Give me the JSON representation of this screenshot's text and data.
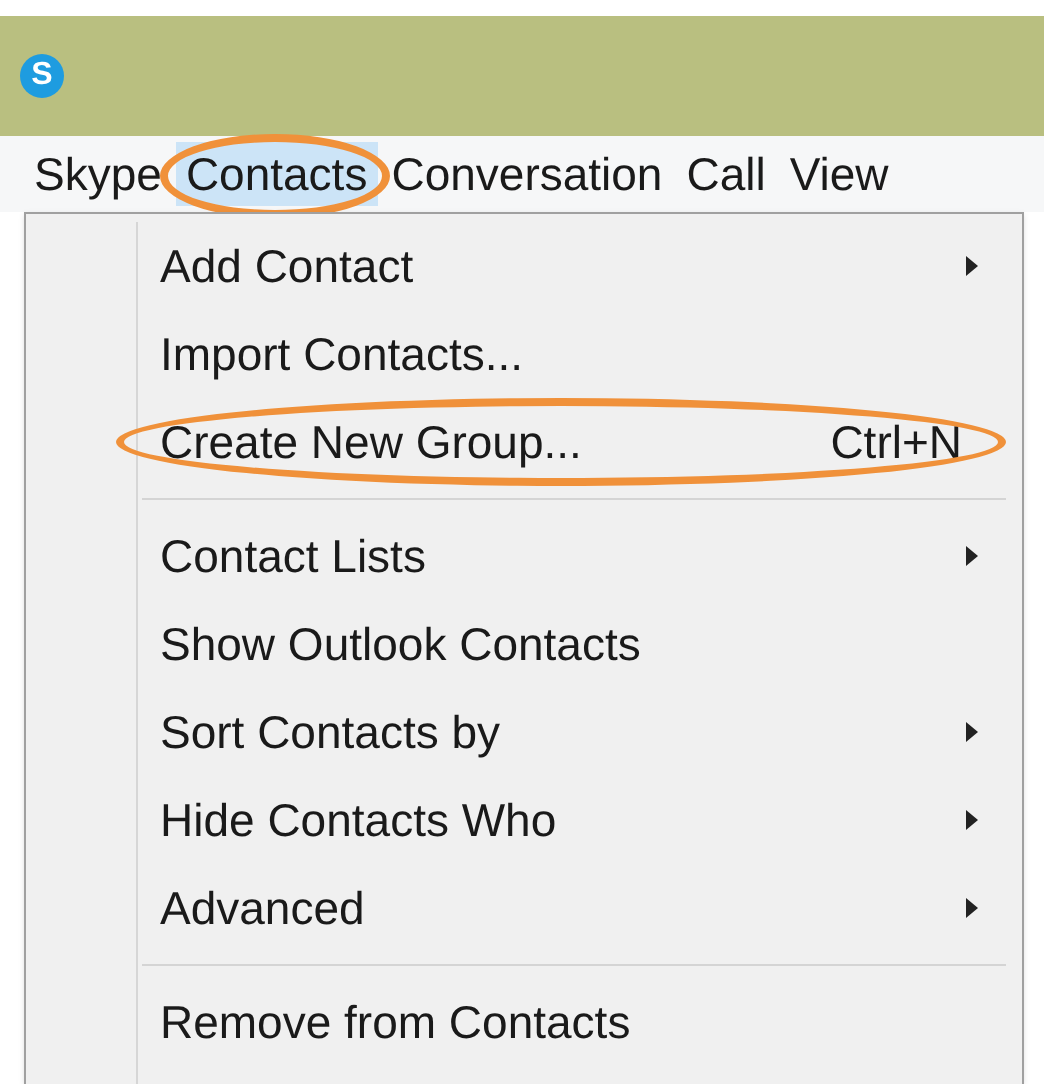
{
  "title_bar": {
    "logo_letter": "S"
  },
  "menu_bar": [
    {
      "label": "Skype",
      "selected": false,
      "annotated": false
    },
    {
      "label": "Contacts",
      "selected": true,
      "annotated": true
    },
    {
      "label": "Conversation",
      "selected": false,
      "annotated": false
    },
    {
      "label": "Call",
      "selected": false,
      "annotated": false
    },
    {
      "label": "View",
      "selected": false,
      "annotated": false
    }
  ],
  "menu": {
    "items": [
      {
        "kind": "item",
        "label": "Add Contact",
        "submenu": true,
        "annotated": false
      },
      {
        "kind": "item",
        "label": "Import Contacts...",
        "submenu": false,
        "annotated": false
      },
      {
        "kind": "item",
        "label": "Create New Group...",
        "shortcut": "Ctrl+N",
        "submenu": false,
        "annotated": true
      },
      {
        "kind": "separator"
      },
      {
        "kind": "item",
        "label": "Contact Lists",
        "submenu": true,
        "annotated": false
      },
      {
        "kind": "item",
        "label": "Show Outlook Contacts",
        "submenu": false,
        "annotated": false
      },
      {
        "kind": "item",
        "label": "Sort Contacts by",
        "submenu": true,
        "annotated": false
      },
      {
        "kind": "item",
        "label": "Hide Contacts Who",
        "submenu": true,
        "annotated": false
      },
      {
        "kind": "item",
        "label": "Advanced",
        "submenu": true,
        "annotated": false
      },
      {
        "kind": "separator"
      },
      {
        "kind": "item",
        "label": "Remove from Contacts",
        "submenu": false,
        "annotated": false
      }
    ]
  }
}
